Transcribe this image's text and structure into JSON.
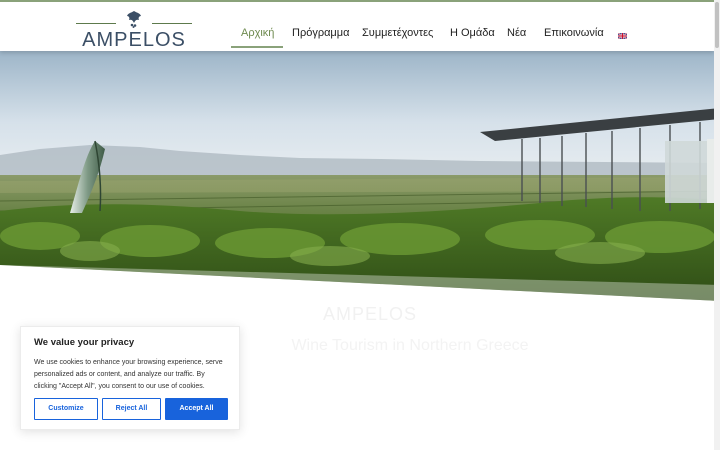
{
  "header": {
    "logo_text": "AMPELOS",
    "nav": [
      {
        "label": "Αρχική",
        "active": true
      },
      {
        "label": "Πρόγραμμα",
        "active": false
      },
      {
        "label": "Συμμετέχοντες",
        "active": false
      },
      {
        "label": "Η Ομάδα",
        "active": false
      },
      {
        "label": "Νέα",
        "active": false
      },
      {
        "label": "Επικοινωνία",
        "active": false
      }
    ],
    "language_icon": "uk-flag-icon"
  },
  "hero": {
    "image": "vineyard-landscape"
  },
  "content": {
    "faded_title": "AMPELOS",
    "faded_subtitle": "Wine Tourism in Northern Greece"
  },
  "cookie_banner": {
    "title": "We value your privacy",
    "text": "We use cookies to enhance your browsing experience, serve personalized ads or content, and analyze our traffic. By clicking \"Accept All\", you consent to our use of cookies.",
    "customize_label": "Customize",
    "reject_label": "Reject All",
    "accept_label": "Accept All"
  },
  "colors": {
    "accent_green": "#8aa27a",
    "active_nav": "#6e8a4f",
    "button_blue": "#1863dc"
  }
}
